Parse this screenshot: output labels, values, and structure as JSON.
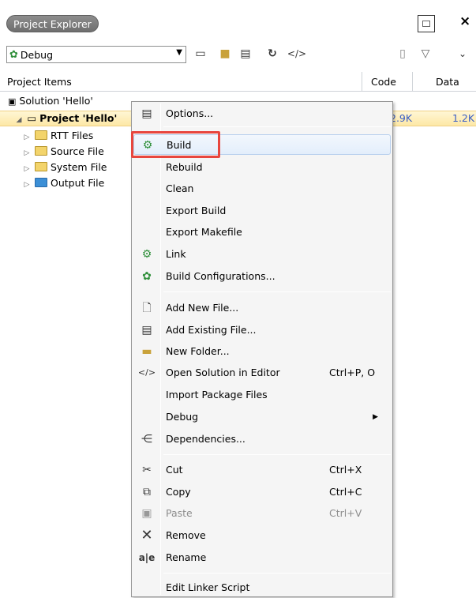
{
  "panel": {
    "title": "Project Explorer",
    "close_label": "×"
  },
  "toolbar": {
    "configuration_value": "Debug",
    "icons": [
      "properties-icon",
      "folder-icon",
      "options-icon",
      "refresh-icon",
      "code-icon",
      "new-file-icon",
      "filter-icon",
      "chevron-down-icon"
    ]
  },
  "columns": {
    "items": "Project Items",
    "code": "Code",
    "data": "Data"
  },
  "tree": {
    "solution": "Solution 'Hello'",
    "project": "Project 'Hello'",
    "project_code": "2.9K",
    "project_data": "1.2K",
    "children": [
      "RTT Files",
      "Source File",
      "System File",
      "Output File"
    ]
  },
  "menu": {
    "items": [
      {
        "label": "Options...",
        "icon": "options-icon",
        "shortcut": ""
      },
      {
        "label": "Build",
        "icon": "build-icon",
        "shortcut": ""
      },
      {
        "label": "Rebuild",
        "icon": "",
        "shortcut": ""
      },
      {
        "label": "Clean",
        "icon": "",
        "shortcut": ""
      },
      {
        "label": "Export Build",
        "icon": "",
        "shortcut": ""
      },
      {
        "label": "Export Makefile",
        "icon": "",
        "shortcut": ""
      },
      {
        "label": "Link",
        "icon": "link-icon",
        "shortcut": ""
      },
      {
        "label": "Build Configurations...",
        "icon": "build-configurations-icon",
        "shortcut": ""
      },
      {
        "label": "Add New File...",
        "icon": "add-new-file-icon",
        "shortcut": ""
      },
      {
        "label": "Add Existing File...",
        "icon": "add-existing-file-icon",
        "shortcut": ""
      },
      {
        "label": "New Folder...",
        "icon": "new-folder-icon",
        "shortcut": ""
      },
      {
        "label": "Open Solution in Editor",
        "icon": "code-icon",
        "shortcut": "Ctrl+P, O"
      },
      {
        "label": "Import Package Files",
        "icon": "",
        "shortcut": ""
      },
      {
        "label": "Debug",
        "icon": "",
        "shortcut": ""
      },
      {
        "label": "Dependencies...",
        "icon": "dependencies-icon",
        "shortcut": ""
      },
      {
        "label": "Cut",
        "icon": "cut-icon",
        "shortcut": "Ctrl+X"
      },
      {
        "label": "Copy",
        "icon": "copy-icon",
        "shortcut": "Ctrl+C"
      },
      {
        "label": "Paste",
        "icon": "paste-icon",
        "shortcut": "Ctrl+V"
      },
      {
        "label": "Remove",
        "icon": "remove-icon",
        "shortcut": ""
      },
      {
        "label": "Rename",
        "icon": "rename-icon",
        "shortcut": ""
      },
      {
        "label": "Edit Linker Script",
        "icon": "",
        "shortcut": ""
      }
    ],
    "highlight_color": "#e8463e"
  }
}
